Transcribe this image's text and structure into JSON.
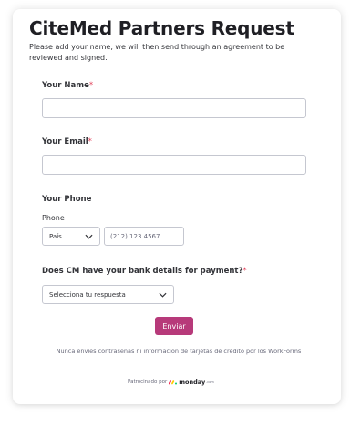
{
  "form": {
    "title": "CiteMed Partners Request",
    "description": "Please add your name, we will then send through an agreement to be reviewed and signed.",
    "required_marker": "*",
    "name_field": {
      "label": "Your Name",
      "value": ""
    },
    "email_field": {
      "label": "Your Email",
      "value": ""
    },
    "phone_field": {
      "label": "Your Phone",
      "sublabel": "Phone",
      "country_select": "País",
      "placeholder": "(212) 123 4567"
    },
    "bank_field": {
      "label": "Does CM have your bank details for payment?",
      "select_value": "Selecciona tu respuesta"
    },
    "submit_label": "Enviar",
    "notice": "Nunca envíes contraseñas ni información de tarjetas de crédito por los WorkForms",
    "sponsor": {
      "prefix": "Patrocinado por",
      "brand": "monday",
      "brand_suffix": ".com"
    }
  },
  "colors": {
    "accent": "#b73a7a",
    "required": "#e2445c",
    "border": "#c5c7d0",
    "text": "#323338",
    "muted": "#676879",
    "logo_red": "#f62b54",
    "logo_yellow": "#ffcc00",
    "logo_green": "#00ca72"
  }
}
